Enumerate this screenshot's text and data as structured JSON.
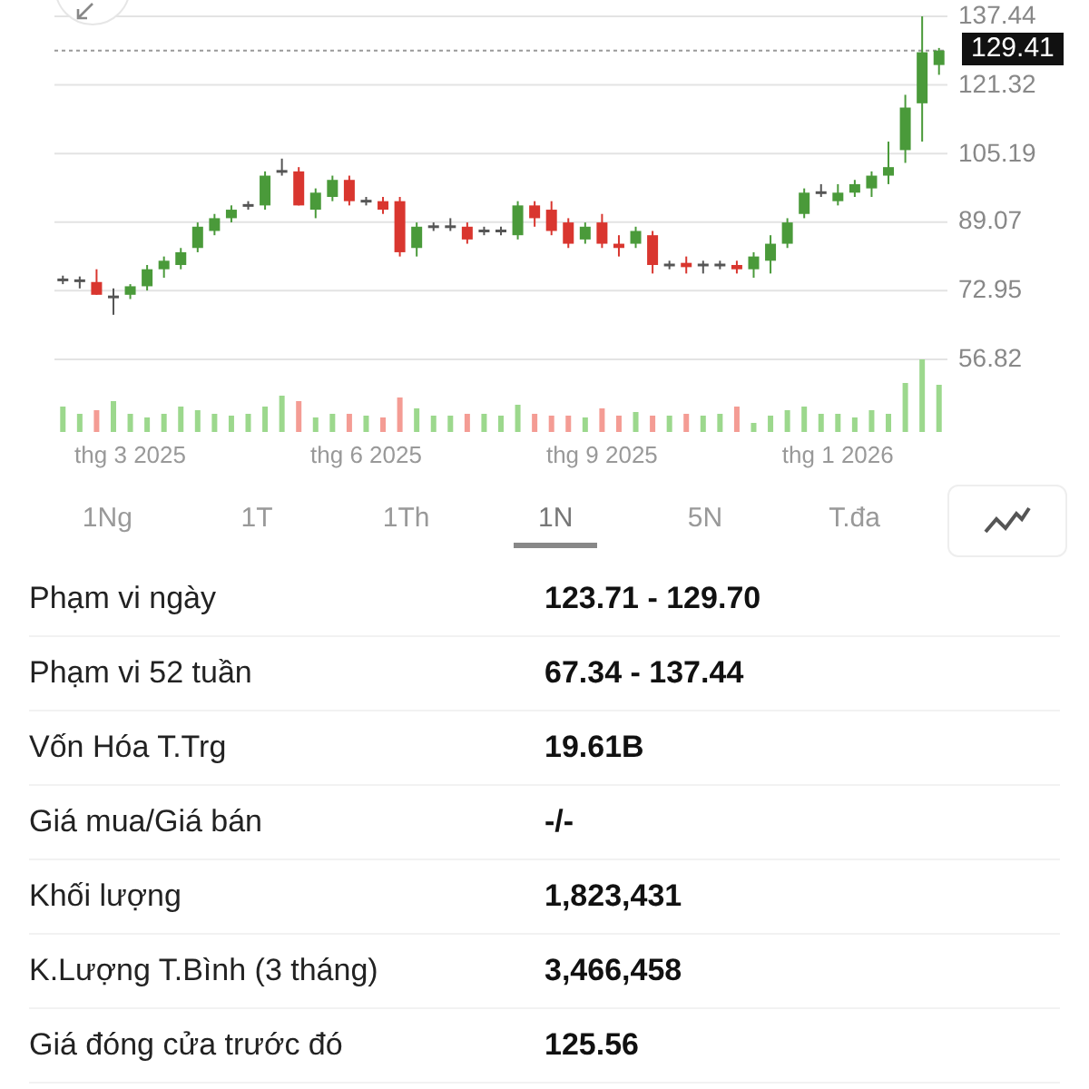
{
  "chart": {
    "chart_data": {
      "type": "candlestick",
      "ylim": [
        56.82,
        137.44
      ],
      "yticks": [
        {
          "value": 137.44,
          "label": "137.44"
        },
        {
          "value": 121.32,
          "label": "121.32"
        },
        {
          "value": 105.19,
          "label": "105.19"
        },
        {
          "value": 89.07,
          "label": "89.07"
        },
        {
          "value": 72.95,
          "label": "72.95"
        },
        {
          "value": 56.82,
          "label": "56.82"
        }
      ],
      "grid": true,
      "ref_lines": [
        {
          "axis": "y",
          "value": 129.41
        }
      ],
      "categories": [
        null,
        null,
        null,
        null,
        "thg 3 2025",
        null,
        null,
        null,
        null,
        null,
        null,
        null,
        null,
        null,
        null,
        null,
        null,
        null,
        "thg 6 2025",
        null,
        null,
        null,
        null,
        null,
        null,
        null,
        null,
        null,
        null,
        null,
        null,
        null,
        "thg 9 2025",
        null,
        null,
        null,
        null,
        null,
        null,
        null,
        null,
        null,
        null,
        null,
        null,
        null,
        "thg 1 2026",
        null,
        null,
        null,
        null,
        null,
        null
      ],
      "ohlc": [
        [
          75.5,
          76.5,
          74.5,
          75.5
        ],
        [
          75.3,
          76.3,
          73.5,
          75.3
        ],
        [
          75,
          78,
          72,
          72
        ],
        [
          71.5,
          73.5,
          67.3,
          71.5
        ],
        [
          72,
          74.5,
          71,
          74
        ],
        [
          74,
          79,
          73,
          78
        ],
        [
          78,
          81,
          76,
          80
        ],
        [
          79,
          83,
          78,
          82
        ],
        [
          83,
          89,
          82,
          88
        ],
        [
          87,
          91,
          86,
          90
        ],
        [
          90,
          93,
          89,
          92
        ],
        [
          93,
          94,
          92,
          93
        ],
        [
          93,
          101,
          92,
          100
        ],
        [
          101,
          104,
          100,
          101
        ],
        [
          101,
          102,
          93,
          93
        ],
        [
          92,
          97,
          90,
          96
        ],
        [
          95,
          100,
          94,
          99
        ],
        [
          99,
          100,
          93,
          94
        ],
        [
          94,
          95,
          93,
          94
        ],
        [
          94,
          95,
          91,
          92
        ],
        [
          94,
          95,
          81,
          82
        ],
        [
          83,
          89,
          81,
          88
        ],
        [
          88,
          89,
          87,
          88
        ],
        [
          88,
          90,
          87,
          88
        ],
        [
          88,
          89,
          84,
          85
        ],
        [
          87,
          88,
          86,
          87
        ],
        [
          87,
          88,
          86,
          87
        ],
        [
          86,
          94,
          85,
          93
        ],
        [
          93,
          94,
          88,
          90
        ],
        [
          92,
          94,
          86,
          87
        ],
        [
          89,
          90,
          83,
          84
        ],
        [
          85,
          89,
          84,
          88
        ],
        [
          89,
          91,
          83,
          84
        ],
        [
          84,
          86,
          81,
          83
        ],
        [
          84,
          88,
          83,
          87
        ],
        [
          86,
          87,
          77,
          79
        ],
        [
          79,
          80,
          78,
          79
        ],
        [
          79.5,
          81,
          77,
          78.5
        ],
        [
          79,
          80,
          77,
          79
        ],
        [
          79,
          80,
          78,
          79
        ],
        [
          79,
          80,
          77,
          78
        ],
        [
          78,
          82,
          76,
          81
        ],
        [
          80,
          86,
          77,
          84
        ],
        [
          84,
          90,
          83,
          89
        ],
        [
          91,
          97,
          90,
          96
        ],
        [
          96,
          98,
          95,
          96
        ],
        [
          94,
          98,
          93,
          96
        ],
        [
          96,
          99,
          95,
          98
        ],
        [
          97,
          101,
          95,
          100
        ],
        [
          100,
          108,
          98,
          102
        ],
        [
          106,
          119,
          103,
          116
        ],
        [
          117,
          137.44,
          108,
          129
        ],
        [
          126,
          130,
          123.7,
          129.4
        ]
      ]
    },
    "last_price": "129.41"
  },
  "tabs": [
    {
      "label": "1Ng",
      "selected": false
    },
    {
      "label": "1T",
      "selected": false
    },
    {
      "label": "1Th",
      "selected": false
    },
    {
      "label": "1N",
      "selected": true
    },
    {
      "label": "5N",
      "selected": false
    },
    {
      "label": "T.đa",
      "selected": false
    }
  ],
  "stats": [
    {
      "label": "Phạm vi ngày",
      "value": "123.71 - 129.70"
    },
    {
      "label": "Phạm vi 52 tuần",
      "value": "67.34 - 137.44"
    },
    {
      "label": "Vốn Hóa T.Trg",
      "value": "19.61B"
    },
    {
      "label": "Giá mua/Giá bán",
      "value": "-/-"
    },
    {
      "label": "Khối lượng",
      "value": "1,823,431"
    },
    {
      "label": "K.Lượng T.Bình (3 tháng)",
      "value": "3,466,458"
    },
    {
      "label": "Giá đóng cửa trước đó",
      "value": "125.56"
    }
  ]
}
